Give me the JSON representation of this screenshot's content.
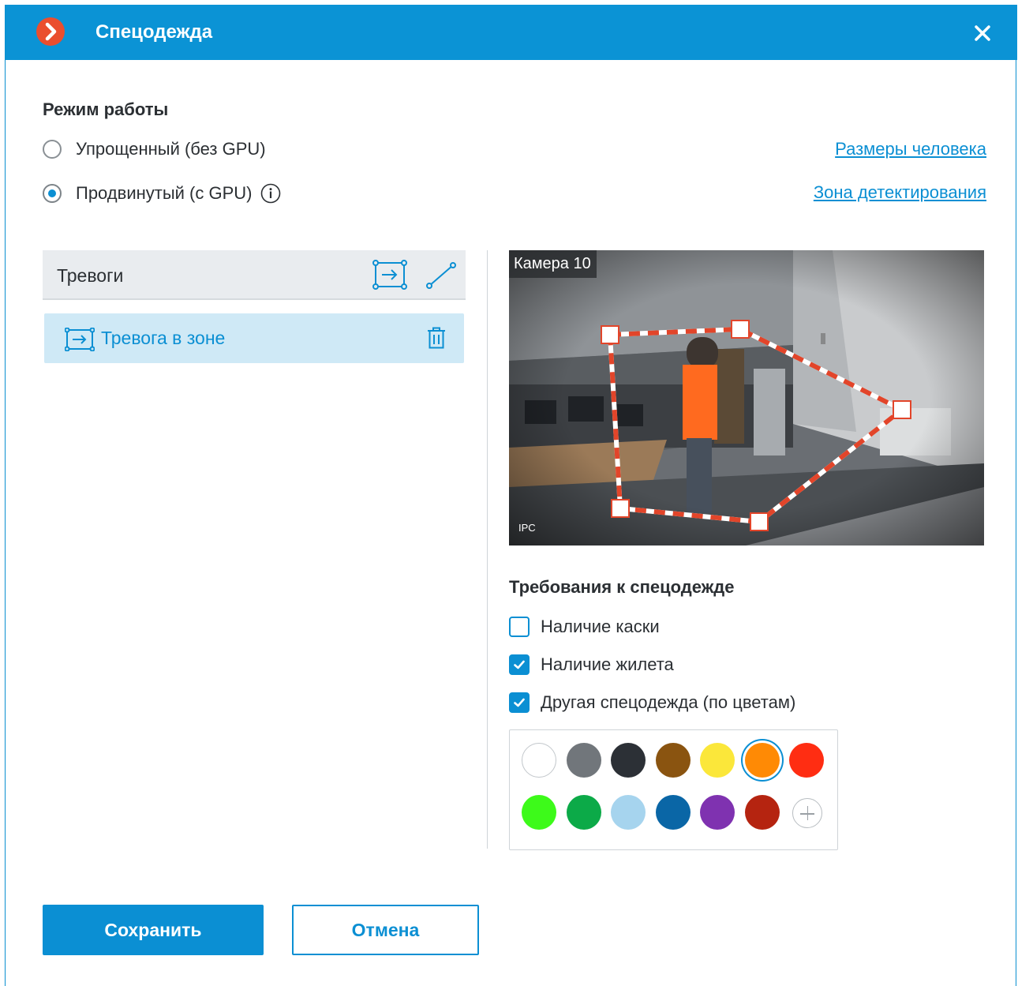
{
  "window": {
    "title": "Спецодежда",
    "close_icon": "close-icon",
    "logo_icon": "app-logo-icon",
    "accent_color": "#0b93d5"
  },
  "mode": {
    "heading": "Режим работы",
    "options": [
      {
        "label": "Упрощенный (без GPU)",
        "checked": false
      },
      {
        "label": "Продвинутый (с GPU)",
        "checked": true,
        "has_info_icon": true
      }
    ]
  },
  "links": {
    "person_size": "Размеры человека",
    "detection_zone": "Зона детектирования"
  },
  "alarms": {
    "header": "Тревоги",
    "header_icons": [
      "zone-alarm-icon",
      "line-alarm-icon"
    ],
    "items": [
      {
        "label": "Тревога в зоне",
        "icon": "zone-alarm-icon",
        "action_icon": "trash-icon"
      }
    ]
  },
  "camera": {
    "name": "Камера 10",
    "watermark": "IPC"
  },
  "requirements": {
    "heading": "Требования к спецодежде",
    "options": [
      {
        "label": "Наличие каски",
        "checked": false
      },
      {
        "label": "Наличие жилета",
        "checked": true
      },
      {
        "label": "Другая спецодежда (по цветам)",
        "checked": true
      }
    ],
    "colors": [
      {
        "hex": "#ffffff",
        "selected": false
      },
      {
        "hex": "#71767b",
        "selected": false
      },
      {
        "hex": "#2c3036",
        "selected": false
      },
      {
        "hex": "#8a5410",
        "selected": false
      },
      {
        "hex": "#fbe73a",
        "selected": false
      },
      {
        "hex": "#ff8a05",
        "selected": true
      },
      {
        "hex": "#ff2d12",
        "selected": false
      },
      {
        "hex": "#3dfa1a",
        "selected": false
      },
      {
        "hex": "#0caa48",
        "selected": false
      },
      {
        "hex": "#a6d4ee",
        "selected": false
      },
      {
        "hex": "#0a66a6",
        "selected": false
      },
      {
        "hex": "#7f32b0",
        "selected": false
      },
      {
        "hex": "#b52410",
        "selected": false
      }
    ],
    "add_color_icon": "plus-icon"
  },
  "buttons": {
    "save": "Сохранить",
    "cancel": "Отмена"
  }
}
